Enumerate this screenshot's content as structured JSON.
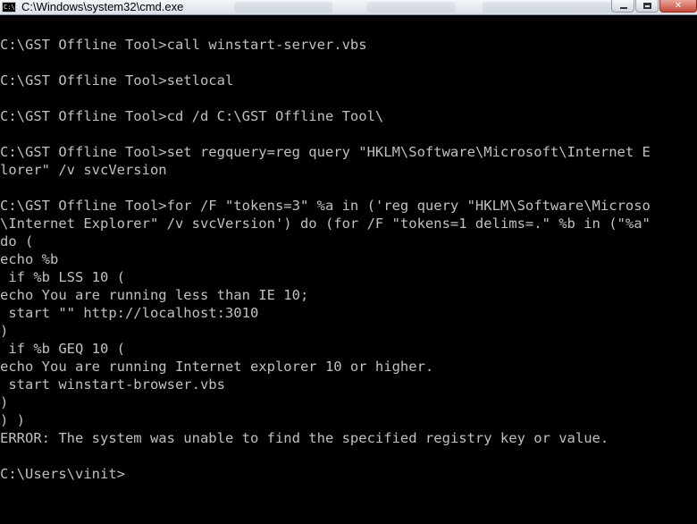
{
  "window": {
    "title": "C:\\Windows\\system32\\cmd.exe",
    "icon_label": "C:\\"
  },
  "console": {
    "lines": [
      "C:\\GST Offline Tool>call winstart-server.vbs",
      "",
      "C:\\GST Offline Tool>setlocal",
      "",
      "C:\\GST Offline Tool>cd /d C:\\GST Offline Tool\\",
      "",
      "C:\\GST Offline Tool>set regquery=reg query \"HKLM\\Software\\Microsoft\\Internet E",
      "lorer\" /v svcVersion",
      "",
      "C:\\GST Offline Tool>for /F \"tokens=3\" %a in ('reg query \"HKLM\\Software\\Microso",
      "\\Internet Explorer\" /v svcVersion') do (for /F \"tokens=1 delims=.\" %b in (\"%a\"",
      "do (",
      "echo %b",
      " if %b LSS 10 (",
      "echo You are running less than IE 10;",
      " start \"\" http://localhost:3010",
      ")",
      " if %b GEQ 10 (",
      "echo You are running Internet explorer 10 or higher.",
      " start winstart-browser.vbs",
      ")",
      ") )",
      "ERROR: The system was unable to find the specified registry key or value.",
      "",
      "C:\\Users\\vinit>"
    ]
  }
}
